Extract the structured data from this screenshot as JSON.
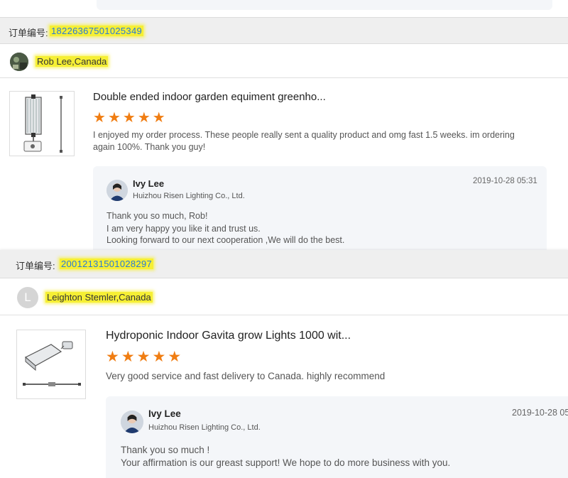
{
  "reviews": [
    {
      "order_label": "订单编号:",
      "order_number": "18226367501025349",
      "buyer_name": "Rob Lee,Canada",
      "product_title": "Double ended indoor garden equiment greenho...",
      "rating": 5,
      "review_lines": [
        "I enjoyed my order process. These people really sent a quality product and omg fast 1.5 weeks. im ordering",
        "again 100%. Thank you guy!"
      ],
      "reply": {
        "seller_name": "Ivy Lee",
        "company": "Huizhou Risen Lighting Co., Ltd.",
        "date": "2019-10-28 05:31",
        "lines": [
          "Thank you so much, Rob!",
          "I am very happy you like it and trust us.",
          "Looking forward to our next cooperation ,We will do the best."
        ]
      }
    },
    {
      "order_label": "订单编号:",
      "order_number": "20012131501028297",
      "buyer_avatar_letter": "L",
      "buyer_name": "Leighton Stemler,Canada",
      "product_title": "Hydroponic Indoor Gavita grow Lights 1000 wit...",
      "rating": 5,
      "review_lines": [
        "Very good service and fast delivery to Canada. highly recommend"
      ],
      "reply": {
        "seller_name": "Ivy Lee",
        "company": "Huizhou Risen Lighting Co., Ltd.",
        "date": "2019-10-28 05:",
        "lines": [
          "Thank you so much !",
          "Your affirmation is our greast support! We hope to do more business with you."
        ]
      }
    }
  ],
  "colors": {
    "accent_link": "#2a7ad6",
    "star": "#f07d12",
    "highlight": "#f6ef34"
  }
}
